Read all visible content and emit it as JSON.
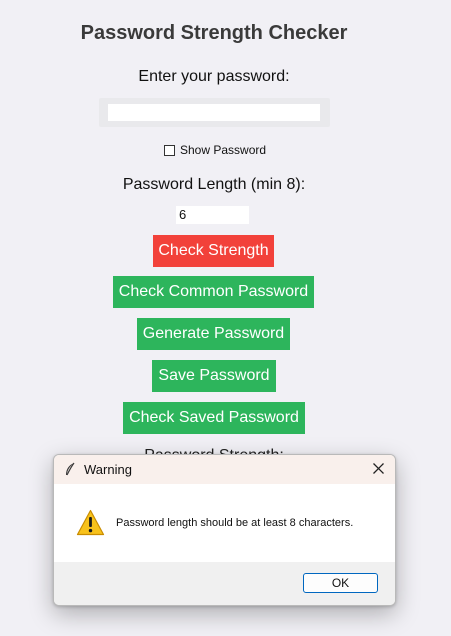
{
  "app": {
    "title": "Password Strength Checker",
    "password_prompt": "Enter your password:",
    "password_value": "",
    "show_password_label": "Show Password",
    "length_label": "Password Length (min 8):",
    "length_value": "6",
    "strength_label": "Password Strength:",
    "buttons": {
      "check_strength": "Check Strength",
      "check_common": "Check Common Password",
      "generate": "Generate Password",
      "save": "Save Password",
      "check_saved": "Check Saved Password"
    },
    "colors": {
      "check_strength": "#f2413a",
      "green_buttons": "#2db55c"
    }
  },
  "dialog": {
    "title": "Warning",
    "message": "Password length should be at least 8 characters.",
    "ok_label": "OK",
    "icons": {
      "app_icon": "feather-icon",
      "close": "close-icon",
      "warning": "warning-icon"
    }
  }
}
